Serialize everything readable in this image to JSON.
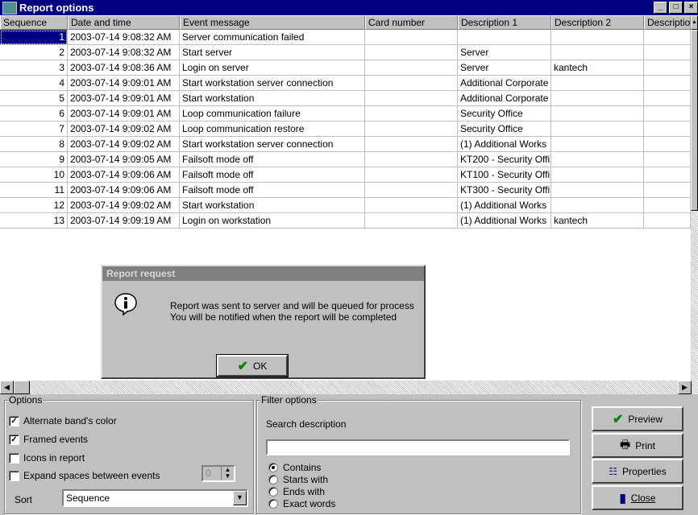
{
  "window": {
    "title": "Report options"
  },
  "columns": [
    "Sequence",
    "Date and time",
    "Event message",
    "Card number",
    "Description 1",
    "Description 2",
    "Descriptio"
  ],
  "rows": [
    [
      "1",
      "2003-07-14 9:08:32 AM",
      "Server communication failed",
      "",
      "",
      ""
    ],
    [
      "2",
      "2003-07-14 9:08:32 AM",
      "Start server",
      "",
      "Server",
      ""
    ],
    [
      "3",
      "2003-07-14 9:08:36 AM",
      "Login on server",
      "",
      "Server",
      "kantech"
    ],
    [
      "4",
      "2003-07-14 9:09:01 AM",
      "Start workstation server connection",
      "",
      "Additional Corporate",
      ""
    ],
    [
      "5",
      "2003-07-14 9:09:01 AM",
      "Start workstation",
      "",
      "Additional Corporate",
      ""
    ],
    [
      "6",
      "2003-07-14 9:09:01 AM",
      "Loop communication failure",
      "",
      "Security Office",
      ""
    ],
    [
      "7",
      "2003-07-14 9:09:02 AM",
      "Loop communication restore",
      "",
      "Security Office",
      ""
    ],
    [
      "8",
      "2003-07-14 9:09:02 AM",
      "Start workstation server connection",
      "",
      "(1) Additional Works",
      ""
    ],
    [
      "9",
      "2003-07-14 9:09:05 AM",
      "Failsoft mode off",
      "",
      "KT200 - Security Offi",
      ""
    ],
    [
      "10",
      "2003-07-14 9:09:06 AM",
      "Failsoft mode off",
      "",
      "KT100 - Security Offi",
      ""
    ],
    [
      "11",
      "2003-07-14 9:09:06 AM",
      "Failsoft mode off",
      "",
      "KT300 - Security Offi",
      ""
    ],
    [
      "12",
      "2003-07-14 9:09:02 AM",
      "Start workstation",
      "",
      "(1) Additional Works",
      ""
    ],
    [
      "13",
      "2003-07-14 9:09:19 AM",
      "Login on workstation",
      "",
      "(1) Additional Works",
      "kantech"
    ]
  ],
  "dialog": {
    "title": "Report request",
    "line1": "Report was sent to server and will be queued for process",
    "line2": "You will be notified when the report will be completed",
    "ok_label": "OK"
  },
  "options": {
    "legend": "Options",
    "alternate_color": {
      "label": "Alternate band's color",
      "checked": true
    },
    "framed_events": {
      "label": "Framed events",
      "checked": true
    },
    "icons_in_report": {
      "label": "Icons in report",
      "checked": false
    },
    "expand_spaces": {
      "label": "Expand spaces between events",
      "checked": false
    },
    "spacing_value": "0",
    "sort_label": "Sort",
    "sort_value": "Sequence"
  },
  "filter": {
    "legend": "Filter options",
    "search_label": "Search description",
    "search_value": "",
    "radios": [
      {
        "label": "Contains",
        "selected": true
      },
      {
        "label": "Starts with",
        "selected": false
      },
      {
        "label": "Ends with",
        "selected": false
      },
      {
        "label": "Exact words",
        "selected": false
      }
    ]
  },
  "buttons": {
    "preview": "Preview",
    "print": "Print",
    "properties": "Properties",
    "close": "Close"
  }
}
